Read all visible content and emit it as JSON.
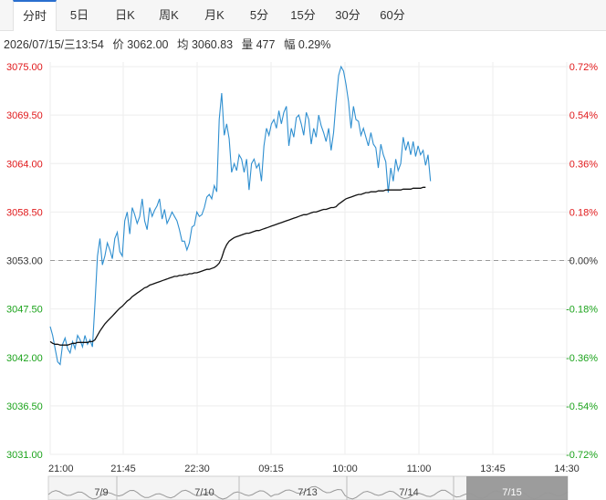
{
  "tabs": [
    {
      "label": "分时",
      "active": true
    },
    {
      "label": "5日",
      "active": false
    },
    {
      "label": "日K",
      "active": false
    },
    {
      "label": "周K",
      "active": false
    },
    {
      "label": "月K",
      "active": false
    },
    {
      "label": "5分",
      "active": false
    },
    {
      "label": "15分",
      "active": false
    },
    {
      "label": "30分",
      "active": false
    },
    {
      "label": "60分",
      "active": false
    }
  ],
  "info": {
    "datetime": "2026/07/15/三13:54",
    "price": "价 3062.00",
    "avg": "均 3060.83",
    "volume": "量 477",
    "change": "幅 0.29%"
  },
  "colors": {
    "up": "#e0191b",
    "down": "#1ca31c",
    "neutral": "#333333",
    "price_line": "#2f8fd0",
    "avg_line": "#111111"
  },
  "chart_data": {
    "type": "line",
    "ylim": [
      3031,
      3075
    ],
    "reference_price": 3053.0,
    "grid": true,
    "price_ticks": [
      "3075.00",
      "3069.50",
      "3064.00",
      "3058.50",
      "3053.00",
      "3047.50",
      "3042.00",
      "3036.50",
      "3031.00"
    ],
    "percent_ticks": [
      "0.72%",
      "0.54%",
      "0.36%",
      "0.18%",
      "0.00%",
      "-0.18%",
      "-0.36%",
      "-0.54%",
      "-0.72%"
    ],
    "time_ticks": [
      "21:00",
      "21:45",
      "22:30",
      "09:15",
      "10:00",
      "11:00",
      "13:45",
      "14:30"
    ],
    "series": [
      {
        "values": [
          3045.5,
          3044.5,
          3043.0,
          3041.5,
          3041.2,
          3043.5,
          3044.2,
          3043.0,
          3042.5,
          3043.8,
          3043.0,
          3044.5,
          3044.0,
          3043.2,
          3044.5,
          3043.5,
          3044.0,
          3043.2,
          3048.0,
          3053.5,
          3055.5,
          3052.5,
          3053.5,
          3055.0,
          3054.2,
          3053.2,
          3055.5,
          3056.2,
          3054.0,
          3053.5,
          3057.5,
          3058.5,
          3056.0,
          3059.0,
          3058.2,
          3057.2,
          3058.0,
          3060.0,
          3057.5,
          3056.5,
          3059.0,
          3058.0,
          3058.7,
          3059.2,
          3060.0,
          3057.7,
          3058.8,
          3057.2,
          3057.8,
          3058.5,
          3058.0,
          3057.5,
          3056.5,
          3055.2,
          3055.2,
          3054.2,
          3055.0,
          3056.8,
          3057.0,
          3058.5,
          3058.0,
          3058.2,
          3059.0,
          3060.2,
          3060.5,
          3060.0,
          3061.5,
          3060.8,
          3069.0,
          3072.0,
          3067.2,
          3068.5,
          3066.8,
          3063.0,
          3064.0,
          3063.2,
          3065.0,
          3064.5,
          3063.0,
          3064.5,
          3061.0,
          3064.0,
          3064.5,
          3063.5,
          3064.0,
          3062.0,
          3066.0,
          3068.0,
          3067.2,
          3068.5,
          3069.0,
          3068.0,
          3070.0,
          3068.5,
          3069.8,
          3070.5,
          3066.0,
          3068.0,
          3067.0,
          3069.2,
          3069.5,
          3068.5,
          3067.2,
          3069.8,
          3069.0,
          3066.2,
          3068.0,
          3067.0,
          3069.5,
          3068.3,
          3067.5,
          3066.5,
          3068.0,
          3065.5,
          3067.5,
          3071.0,
          3074.0,
          3075.0,
          3074.5,
          3073.0,
          3071.0,
          3068.0,
          3070.5,
          3069.0,
          3068.8,
          3067.2,
          3068.0,
          3067.0,
          3066.0,
          3067.5,
          3066.2,
          3065.8,
          3063.5,
          3066.2,
          3065.0,
          3064.2,
          3060.7,
          3063.5,
          3062.0,
          3064.5,
          3063.2,
          3064.0,
          3067.0,
          3065.5,
          3066.5,
          3065.0,
          3066.5,
          3064.8,
          3066.0,
          3065.0,
          3065.5,
          3063.8,
          3065.0,
          3062.0
        ]
      },
      {
        "values": [
          3043.8,
          3043.6,
          3043.5,
          3043.5,
          3043.4,
          3043.4,
          3043.4,
          3043.4,
          3043.5,
          3043.6,
          3043.6,
          3043.7,
          3043.7,
          3043.7,
          3043.7,
          3043.7,
          3043.8,
          3043.8,
          3044.0,
          3044.5,
          3045.0,
          3045.4,
          3045.8,
          3046.1,
          3046.4,
          3046.7,
          3047.0,
          3047.3,
          3047.6,
          3047.8,
          3048.1,
          3048.4,
          3048.6,
          3048.9,
          3049.1,
          3049.3,
          3049.5,
          3049.7,
          3049.9,
          3050.0,
          3050.2,
          3050.3,
          3050.4,
          3050.5,
          3050.6,
          3050.7,
          3050.8,
          3050.9,
          3051.0,
          3051.1,
          3051.2,
          3051.2,
          3051.3,
          3051.3,
          3051.4,
          3051.4,
          3051.5,
          3051.5,
          3051.6,
          3051.6,
          3051.7,
          3051.8,
          3051.9,
          3052.0,
          3052.0,
          3052.1,
          3052.2,
          3052.4,
          3052.7,
          3053.3,
          3054.2,
          3054.8,
          3055.2,
          3055.4,
          3055.6,
          3055.7,
          3055.8,
          3055.9,
          3056.0,
          3056.1,
          3056.1,
          3056.2,
          3056.3,
          3056.4,
          3056.4,
          3056.5,
          3056.6,
          3056.7,
          3056.8,
          3056.9,
          3057.0,
          3057.1,
          3057.2,
          3057.3,
          3057.4,
          3057.5,
          3057.6,
          3057.7,
          3057.8,
          3057.9,
          3058.0,
          3058.1,
          3058.2,
          3058.2,
          3058.3,
          3058.4,
          3058.5,
          3058.5,
          3058.6,
          3058.7,
          3058.8,
          3058.8,
          3058.9,
          3059.0,
          3059.0,
          3059.1,
          3059.4,
          3059.6,
          3059.8,
          3060.0,
          3060.1,
          3060.2,
          3060.3,
          3060.4,
          3060.5,
          3060.5,
          3060.6,
          3060.7,
          3060.7,
          3060.8,
          3060.8,
          3060.8,
          3060.9,
          3060.9,
          3060.9,
          3061.0,
          3061.0,
          3061.0,
          3061.0,
          3061.0,
          3061.0,
          3061.0,
          3061.1,
          3061.1,
          3061.1,
          3061.1,
          3061.2,
          3061.2,
          3061.2,
          3061.2,
          3061.3,
          3061.3
        ]
      }
    ]
  },
  "navigator": {
    "dates": [
      "7/9",
      "7/10",
      "7/13",
      "7/14",
      "7/15"
    ]
  }
}
